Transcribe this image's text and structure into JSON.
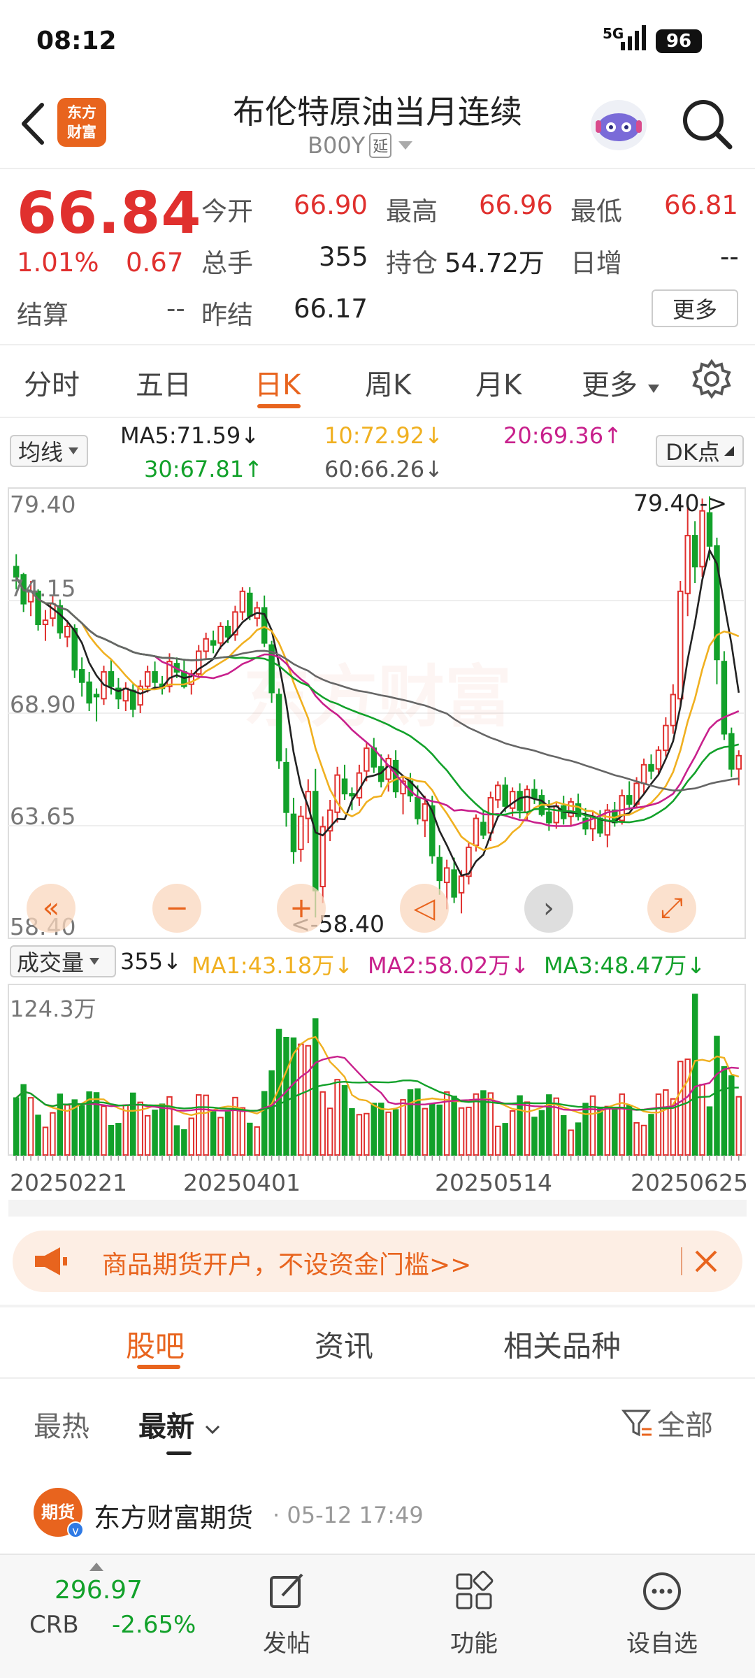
{
  "status": {
    "time": "08:12",
    "network": "5G",
    "battery": "96"
  },
  "header": {
    "title": "布伦特原油当月连续",
    "code": "B00Y",
    "delay_badge": "延"
  },
  "quote": {
    "price": "66.84",
    "change_pct": "1.01%",
    "change": "0.67",
    "settle_label": "结算",
    "settle_value": "--",
    "fields": [
      {
        "label": "今开",
        "value": "66.90"
      },
      {
        "label": "最高",
        "value": "66.96"
      },
      {
        "label": "最低",
        "value": "66.81"
      },
      {
        "label": "总手",
        "value": "355"
      },
      {
        "label": "持仓",
        "value": "54.72万"
      },
      {
        "label": "日增",
        "value": "--"
      },
      {
        "label": "昨结",
        "value": "66.17"
      }
    ],
    "more_button": "更多"
  },
  "tabs": [
    "分时",
    "五日",
    "日K",
    "周K",
    "月K",
    "更多"
  ],
  "active_tab": 2,
  "ma_panel": {
    "selector": "均线",
    "ma5": "MA5:71.59↓",
    "ma10": "10:72.92↓",
    "ma20": "20:69.36↑",
    "ma30": "30:67.81↑",
    "ma60": "60:66.26↓",
    "dk_button": "DK点"
  },
  "price_axis": [
    "79.40",
    "74.15",
    "68.90",
    "63.65",
    "58.40"
  ],
  "price_annotations": {
    "high": "79.40->",
    "low": "<-58.40"
  },
  "volume_panel": {
    "selector": "成交量",
    "vol": "355↓",
    "ma1": "MA1:43.18万↓",
    "ma2": "MA2:58.02万↓",
    "ma3": "MA3:48.47万↓",
    "axis_max": "124.3万"
  },
  "date_axis": [
    "20250221",
    "20250401",
    "20250514",
    "20250625"
  ],
  "colors": {
    "up": "#e0302e",
    "down": "#12a12a",
    "ma5": "#222222",
    "ma10": "#f0b020",
    "ma20": "#c8208c",
    "ma30": "#12a12a",
    "ma60": "#666666",
    "accent": "#e8641e"
  },
  "banner": {
    "text": "商品期货开户，不设资金门槛>>"
  },
  "section_tabs": [
    "股吧",
    "资讯",
    "相关品种"
  ],
  "filters": {
    "hot": "最热",
    "new": "最新",
    "all": "全部"
  },
  "post": {
    "author": "东方财富期货",
    "time": "· 05-12 17:49",
    "avatar_text": "期货"
  },
  "bottom": {
    "index_value": "296.97",
    "index_name": "CRB",
    "index_change": "-2.65%",
    "post_label": "发帖",
    "func_label": "功能",
    "watch_label": "设自选"
  },
  "chart_data": {
    "type": "candlestick",
    "ylim": [
      58.4,
      79.4
    ],
    "x_ticks": [
      "20250221",
      "20250401",
      "20250514",
      "20250625"
    ],
    "ohlc": [
      [
        76.0,
        76.6,
        74.9,
        75.5
      ],
      [
        75.6,
        75.7,
        73.8,
        74.2
      ],
      [
        74.3,
        75.3,
        73.6,
        74.8
      ],
      [
        74.8,
        74.9,
        72.9,
        73.2
      ],
      [
        73.2,
        73.9,
        72.4,
        73.4
      ],
      [
        73.5,
        74.6,
        73.1,
        74.2
      ],
      [
        74.1,
        74.4,
        72.5,
        72.8
      ],
      [
        72.6,
        73.4,
        72.1,
        73.1
      ],
      [
        73.0,
        73.2,
        70.6,
        71.0
      ],
      [
        71.0,
        71.6,
        69.7,
        70.4
      ],
      [
        70.4,
        70.9,
        69.0,
        69.4
      ],
      [
        69.8,
        70.1,
        68.5,
        69.7
      ],
      [
        69.6,
        71.2,
        69.3,
        70.9
      ],
      [
        70.9,
        71.5,
        69.8,
        70.2
      ],
      [
        70.1,
        70.6,
        69.1,
        69.6
      ],
      [
        69.5,
        70.4,
        69.0,
        70.1
      ],
      [
        70.0,
        70.3,
        68.7,
        69.1
      ],
      [
        69.3,
        70.5,
        68.9,
        70.2
      ],
      [
        70.2,
        71.2,
        69.9,
        70.9
      ],
      [
        70.9,
        71.4,
        70.1,
        70.4
      ],
      [
        70.3,
        70.7,
        69.8,
        70.1
      ],
      [
        70.2,
        71.8,
        69.9,
        71.4
      ],
      [
        71.3,
        71.6,
        70.6,
        70.9
      ],
      [
        70.9,
        71.5,
        70.1,
        70.2
      ],
      [
        70.3,
        71.0,
        69.8,
        70.8
      ],
      [
        70.8,
        72.2,
        70.7,
        71.9
      ],
      [
        71.9,
        72.8,
        71.5,
        72.5
      ],
      [
        72.4,
        72.9,
        71.8,
        72.2
      ],
      [
        72.3,
        73.3,
        72.0,
        73.1
      ],
      [
        73.1,
        73.4,
        72.3,
        72.6
      ],
      [
        72.7,
        74.1,
        72.4,
        73.8
      ],
      [
        73.8,
        75.0,
        73.4,
        74.8
      ],
      [
        74.7,
        75.0,
        73.4,
        73.6
      ],
      [
        73.5,
        74.3,
        73.1,
        74.0
      ],
      [
        74.0,
        74.6,
        72.1,
        72.3
      ],
      [
        72.2,
        72.4,
        69.4,
        69.9
      ],
      [
        69.8,
        70.1,
        66.2,
        66.6
      ],
      [
        66.5,
        67.2,
        63.4,
        64.1
      ],
      [
        64.0,
        64.8,
        61.6,
        62.2
      ],
      [
        62.3,
        64.4,
        61.7,
        63.9
      ],
      [
        63.8,
        65.7,
        62.6,
        65.1
      ],
      [
        65.1,
        66.2,
        59.0,
        60.3
      ],
      [
        60.5,
        63.9,
        59.7,
        63.4
      ],
      [
        63.2,
        64.7,
        62.7,
        64.2
      ],
      [
        64.1,
        66.3,
        63.6,
        65.9
      ],
      [
        65.7,
        66.4,
        64.7,
        65.0
      ],
      [
        65.0,
        65.3,
        64.2,
        64.9
      ],
      [
        64.8,
        66.4,
        64.4,
        66.0
      ],
      [
        66.1,
        67.5,
        65.6,
        67.2
      ],
      [
        67.2,
        67.7,
        66.0,
        66.3
      ],
      [
        66.3,
        66.9,
        65.3,
        65.6
      ],
      [
        65.7,
        66.9,
        65.1,
        66.7
      ],
      [
        66.6,
        67.1,
        64.8,
        65.1
      ],
      [
        65.0,
        65.9,
        64.0,
        65.6
      ],
      [
        65.6,
        66.0,
        64.6,
        64.9
      ],
      [
        64.8,
        65.4,
        63.5,
        63.8
      ],
      [
        63.7,
        64.9,
        62.9,
        64.5
      ],
      [
        64.4,
        64.9,
        61.6,
        62.0
      ],
      [
        61.9,
        62.5,
        60.1,
        60.8
      ],
      [
        60.7,
        61.8,
        59.4,
        61.4
      ],
      [
        61.3,
        61.9,
        59.7,
        60.0
      ],
      [
        60.2,
        61.3,
        59.2,
        61.0
      ],
      [
        61.0,
        62.6,
        60.6,
        62.4
      ],
      [
        62.5,
        64.0,
        62.2,
        63.8
      ],
      [
        63.6,
        64.2,
        62.8,
        63.0
      ],
      [
        63.1,
        65.1,
        62.7,
        64.8
      ],
      [
        64.7,
        65.6,
        64.3,
        65.4
      ],
      [
        65.4,
        65.8,
        64.1,
        64.4
      ],
      [
        64.3,
        65.3,
        63.9,
        65.1
      ],
      [
        65.1,
        65.5,
        63.8,
        64.2
      ],
      [
        64.1,
        65.4,
        63.7,
        65.2
      ],
      [
        65.2,
        65.7,
        64.5,
        64.8
      ],
      [
        64.9,
        65.2,
        63.9,
        64.0
      ],
      [
        64.1,
        64.7,
        63.2,
        63.6
      ],
      [
        63.6,
        64.6,
        63.3,
        64.4
      ],
      [
        64.4,
        64.9,
        63.5,
        63.8
      ],
      [
        63.9,
        64.8,
        63.4,
        64.6
      ],
      [
        64.5,
        65.0,
        63.7,
        63.9
      ],
      [
        63.8,
        64.3,
        63.0,
        63.3
      ],
      [
        63.3,
        64.1,
        62.7,
        63.9
      ],
      [
        63.8,
        64.2,
        62.9,
        63.1
      ],
      [
        63.0,
        64.5,
        62.4,
        64.2
      ],
      [
        64.2,
        64.6,
        63.4,
        63.6
      ],
      [
        63.7,
        65.2,
        63.5,
        64.9
      ],
      [
        64.9,
        65.6,
        64.2,
        64.5
      ],
      [
        64.5,
        65.8,
        64.3,
        65.5
      ],
      [
        65.5,
        66.7,
        65.0,
        66.4
      ],
      [
        66.4,
        66.9,
        65.7,
        66.1
      ],
      [
        66.2,
        67.3,
        65.9,
        67.1
      ],
      [
        67.1,
        68.7,
        66.8,
        68.3
      ],
      [
        68.3,
        70.3,
        67.9,
        69.8
      ],
      [
        69.6,
        75.3,
        69.3,
        74.8
      ],
      [
        74.7,
        79.0,
        73.6,
        77.5
      ],
      [
        77.5,
        78.2,
        75.2,
        76.0
      ],
      [
        76.0,
        79.3,
        75.5,
        78.7
      ],
      [
        78.6,
        79.4,
        76.3,
        77.0
      ],
      [
        77.0,
        77.4,
        70.3,
        71.5
      ],
      [
        71.4,
        71.9,
        67.6,
        67.9
      ],
      [
        67.9,
        68.2,
        65.8,
        66.2
      ],
      [
        66.2,
        67.1,
        65.4,
        66.84
      ]
    ],
    "volume_max_wan": 124.3
  }
}
